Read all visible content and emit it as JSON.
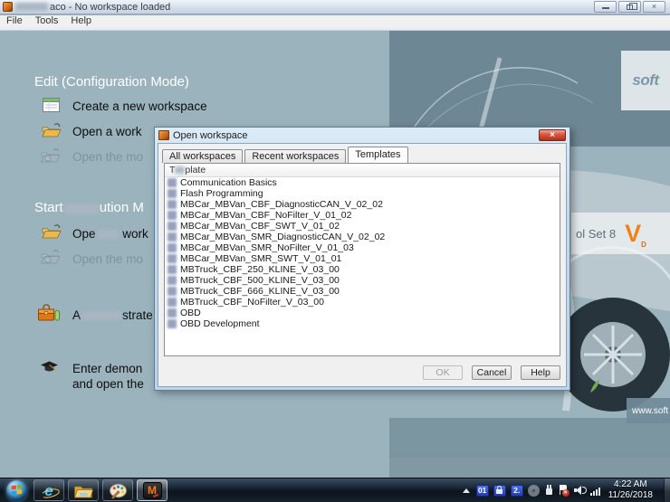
{
  "colors": {
    "desktop_bg": "#9bb3bd",
    "accent_orange": "#f08019",
    "close_red": "#d9543c",
    "tray_badge_blue": "#2b4bd7"
  },
  "window": {
    "title_visible": "aco  - No workspace loaded",
    "menus": [
      "File",
      "Tools",
      "Help"
    ],
    "close_glyph": "×"
  },
  "home": {
    "edit_section": {
      "heading": "Edit (Configuration Mode)",
      "item_new": "Create a new workspace",
      "item_open": "Open a work",
      "item_open_recent": "Open the mo"
    },
    "start_section": {
      "heading_part1": "Start",
      "heading_part2": "ution M",
      "item_open_part1": "Ope",
      "item_open_part2": " work",
      "item_open_recent": "Open the mo",
      "item_admin_part1": "A",
      "item_admin_part2": "strate",
      "item_demo_line1": "Enter demon",
      "item_demo_line2": "and open the"
    },
    "branding": {
      "logo_text": "soft",
      "banner_text": "ol Set 8",
      "banner_mark": "V",
      "banner_sub": "D",
      "url_text": "www.soft"
    }
  },
  "dialog": {
    "title": "Open workspace",
    "tabs": [
      "All workspaces",
      "Recent workspaces",
      "Templates"
    ],
    "active_tab": "Templates",
    "list_header_part1": "T",
    "list_header_part2": "plate",
    "templates": [
      "Communication Basics",
      "Flash Programming",
      "MBCar_MBVan_CBF_DiagnosticCAN_V_02_02",
      "MBCar_MBVan_CBF_NoFilter_V_01_02",
      "MBCar_MBVan_CBF_SWT_V_01_02",
      "MBCar_MBVan_SMR_DiagnosticCAN_V_02_02",
      "MBCar_MBVan_SMR_NoFilter_V_01_03",
      "MBCar_MBVan_SMR_SWT_V_01_01",
      "MBTruck_CBF_250_KLINE_V_03_00",
      "MBTruck_CBF_500_KLINE_V_03_00",
      "MBTruck_CBF_666_KLINE_V_03_00",
      "MBTruck_CBF_NoFilter_V_03_00",
      "OBD",
      "OBD Development"
    ],
    "buttons": {
      "ok": "OK",
      "cancel": "Cancel",
      "help": "Help"
    },
    "ok_enabled": false
  },
  "taskbar": {
    "ie_letter": "e",
    "monaco_letter": "M",
    "tray_badge1": "01",
    "tray_badge2": "2.",
    "flag_error_glyph": "×",
    "clock_time": "4:22 AM",
    "clock_date": "11/26/2018"
  }
}
